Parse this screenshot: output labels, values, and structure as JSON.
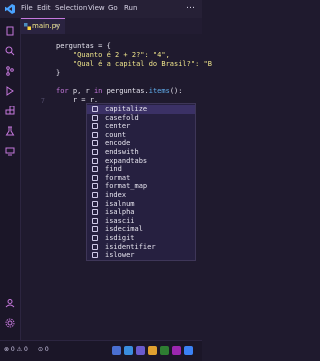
{
  "titlebar": {
    "menus": [
      "File",
      "Edit",
      "Selection",
      "View",
      "Go",
      "Run"
    ]
  },
  "tab": {
    "label": "main.py",
    "close": "×"
  },
  "editor": {
    "line_numbers": [
      "7"
    ],
    "lines": [
      {
        "parts": [
          {
            "t": "perguntas = {",
            "c": "var"
          }
        ]
      },
      {
        "parts": [
          {
            "t": "    \"Quanto é 2 + 2?\": \"4\",",
            "c": "str"
          }
        ]
      },
      {
        "parts": [
          {
            "t": "    \"Qual é a capital do Brasil?\": \"B",
            "c": "str"
          }
        ]
      },
      {
        "parts": [
          {
            "t": "}",
            "c": "var"
          }
        ]
      },
      {
        "parts": [
          {
            "t": "",
            "c": "var"
          }
        ]
      },
      {
        "parts": [
          {
            "t": "for ",
            "c": "kw"
          },
          {
            "t": "p, r ",
            "c": "var"
          },
          {
            "t": "in ",
            "c": "kw"
          },
          {
            "t": "perguntas.",
            "c": "var"
          },
          {
            "t": "items",
            "c": "fn"
          },
          {
            "t": "():",
            "c": "var"
          }
        ]
      },
      {
        "parts": [
          {
            "t": "    r = r.",
            "c": "var"
          }
        ]
      }
    ]
  },
  "suggestions": {
    "selected_index": 0,
    "items": [
      "capitalize",
      "casefold",
      "center",
      "count",
      "encode",
      "endswith",
      "expandtabs",
      "find",
      "format",
      "format_map",
      "index",
      "isalnum",
      "isalpha",
      "isascii",
      "isdecimal",
      "isdigit",
      "isidentifier",
      "islower"
    ]
  },
  "statusbar": {
    "problems": "⊗ 0 ⚠ 0",
    "ports": "⊙ 0"
  },
  "colors": {
    "accent": "#c678dd",
    "background": "#1f1a2e",
    "selection": "#3b3166"
  }
}
